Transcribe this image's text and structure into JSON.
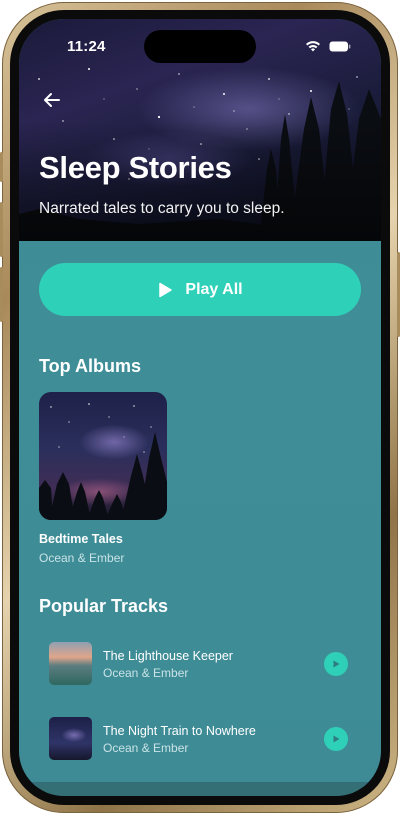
{
  "status_bar": {
    "time": "11:24"
  },
  "header": {
    "title": "Sleep Stories",
    "subtitle": "Narrated tales to carry you to sleep."
  },
  "play_all": {
    "label": "Play All"
  },
  "top_albums": {
    "heading": "Top Albums",
    "items": [
      {
        "name": "Bedtime Tales",
        "artist": "Ocean & Ember"
      }
    ]
  },
  "popular_tracks": {
    "heading": "Popular Tracks",
    "items": [
      {
        "name": "The Lighthouse Keeper",
        "artist": "Ocean & Ember",
        "thumb_icon": "ocean-sunset-thumbnail"
      },
      {
        "name": "The Night Train to Nowhere",
        "artist": "Ocean & Ember",
        "thumb_icon": "night-sky-thumbnail"
      }
    ]
  },
  "colors": {
    "accent": "#2fd0b8",
    "background": "#3e8b96",
    "text_primary": "#ffffff",
    "text_secondary": "#c9e3e6"
  }
}
